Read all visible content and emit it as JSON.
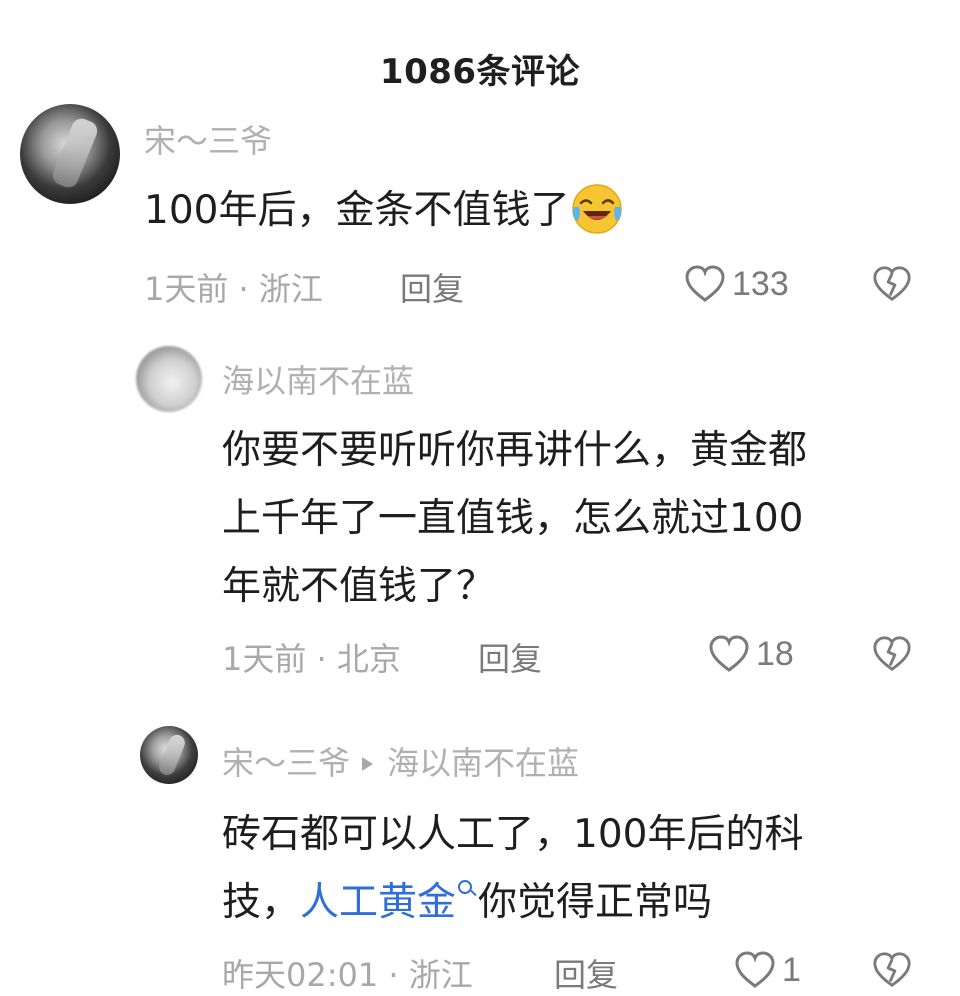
{
  "header": {
    "title": "1086条评论"
  },
  "comment": {
    "username": "宋～三爷",
    "text": "100年后，金条不值钱了",
    "emoji": "laughing-crying-emoji",
    "meta": "1天前 · 浙江",
    "reply_label": "回复",
    "likes": "133"
  },
  "reply1": {
    "username": "海以南不在蓝",
    "lines": [
      "你要不要听听你再讲什么，黄金都",
      "上千年了一直值钱，怎么就过100",
      "年就不值钱了？"
    ],
    "meta": "1天前 · 北京",
    "reply_label": "回复",
    "likes": "18"
  },
  "reply2": {
    "username": "宋～三爷",
    "reply_to": "海以南不在蓝",
    "line1": "砖石都可以人工了，100年后的科",
    "line2_prefix": "技，",
    "link_text": "人工黄金",
    "line2_suffix": "你觉得正常吗",
    "meta": "昨天02:01 · 浙江",
    "reply_label": "回复",
    "likes": "1"
  },
  "colors": {
    "link": "#2f6fd6",
    "muted": "#a8a8a8",
    "text": "#1e1e1e"
  }
}
